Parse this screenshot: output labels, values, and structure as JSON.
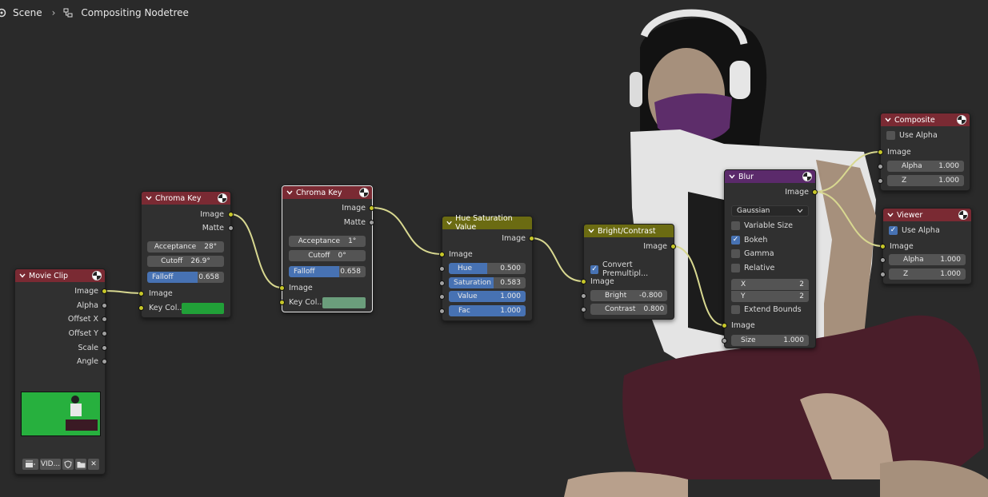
{
  "breadcrumb": {
    "scene": "Scene",
    "nodetree": "Compositing Nodetree",
    "scene_icon": "scene-icon",
    "nodetree_icon": "node-tree-icon"
  },
  "colors": {
    "background": "#2a2a2a",
    "node_body": "#303030",
    "header_input": "#7a2a33",
    "header_color": "#6b6b12",
    "header_filter": "#5b2a6b",
    "socket_color": "#c7c729",
    "socket_value": "#a1a1a1",
    "slider_fill": "#4772b3",
    "key_color_1": "#21a038",
    "key_color_2": "#6b9e7c"
  },
  "nodes": {
    "movie_clip": {
      "title": "Movie Clip",
      "outputs": [
        "Image",
        "Alpha",
        "Offset X",
        "Offset Y",
        "Scale",
        "Angle"
      ],
      "clip_name": "VID...",
      "toolbar_icons": [
        "clip-icon",
        "shield-icon",
        "folder-icon",
        "close-icon"
      ]
    },
    "chroma_key_1": {
      "title": "Chroma Key",
      "outputs": [
        "Image",
        "Matte"
      ],
      "acceptance_label": "Acceptance",
      "acceptance_value": "28°",
      "cutoff_label": "Cutoff",
      "cutoff_value": "26.9°",
      "falloff_label": "Falloff",
      "falloff_value": "0.658",
      "falloff_fraction": 0.658,
      "input_image": "Image",
      "input_key": "Key Col..."
    },
    "chroma_key_2": {
      "title": "Chroma Key",
      "outputs": [
        "Image",
        "Matte"
      ],
      "acceptance_label": "Acceptance",
      "acceptance_value": "1°",
      "cutoff_label": "Cutoff",
      "cutoff_value": "0°",
      "falloff_label": "Falloff",
      "falloff_value": "0.658",
      "falloff_fraction": 0.658,
      "input_image": "Image",
      "input_key": "Key Col..."
    },
    "hue_sat": {
      "title": "Hue Saturation Value",
      "output": "Image",
      "input_image": "Image",
      "hue_label": "Hue",
      "hue_value": "0.500",
      "hue_fraction": 0.5,
      "sat_label": "Saturation",
      "sat_value": "0.583",
      "sat_fraction": 0.583,
      "val_label": "Value",
      "val_value": "1.000",
      "val_fraction": 1.0,
      "fac_label": "Fac",
      "fac_value": "1.000",
      "fac_fraction": 1.0
    },
    "bright": {
      "title": "Bright/Contrast",
      "output": "Image",
      "convert_label": "Convert Premultipl...",
      "convert_checked": true,
      "input_image": "Image",
      "bright_label": "Bright",
      "bright_value": "-0.800",
      "contrast_label": "Contrast",
      "contrast_value": "0.800"
    },
    "blur": {
      "title": "Blur",
      "output": "Image",
      "filter_type": "Gaussian",
      "variable_size": "Variable Size",
      "bokeh": "Bokeh",
      "bokeh_checked": true,
      "gamma": "Gamma",
      "relative": "Relative",
      "x_label": "X",
      "x_value": "2",
      "y_label": "Y",
      "y_value": "2",
      "extend_bounds": "Extend Bounds",
      "input_image": "Image",
      "size_label": "Size",
      "size_value": "1.000"
    },
    "composite": {
      "title": "Composite",
      "use_alpha": "Use Alpha",
      "use_alpha_checked": false,
      "input_image": "Image",
      "alpha_label": "Alpha",
      "alpha_value": "1.000",
      "z_label": "Z",
      "z_value": "1.000"
    },
    "viewer": {
      "title": "Viewer",
      "use_alpha": "Use Alpha",
      "use_alpha_checked": true,
      "input_image": "Image",
      "alpha_label": "Alpha",
      "alpha_value": "1.000",
      "z_label": "Z",
      "z_value": "1.000"
    }
  }
}
